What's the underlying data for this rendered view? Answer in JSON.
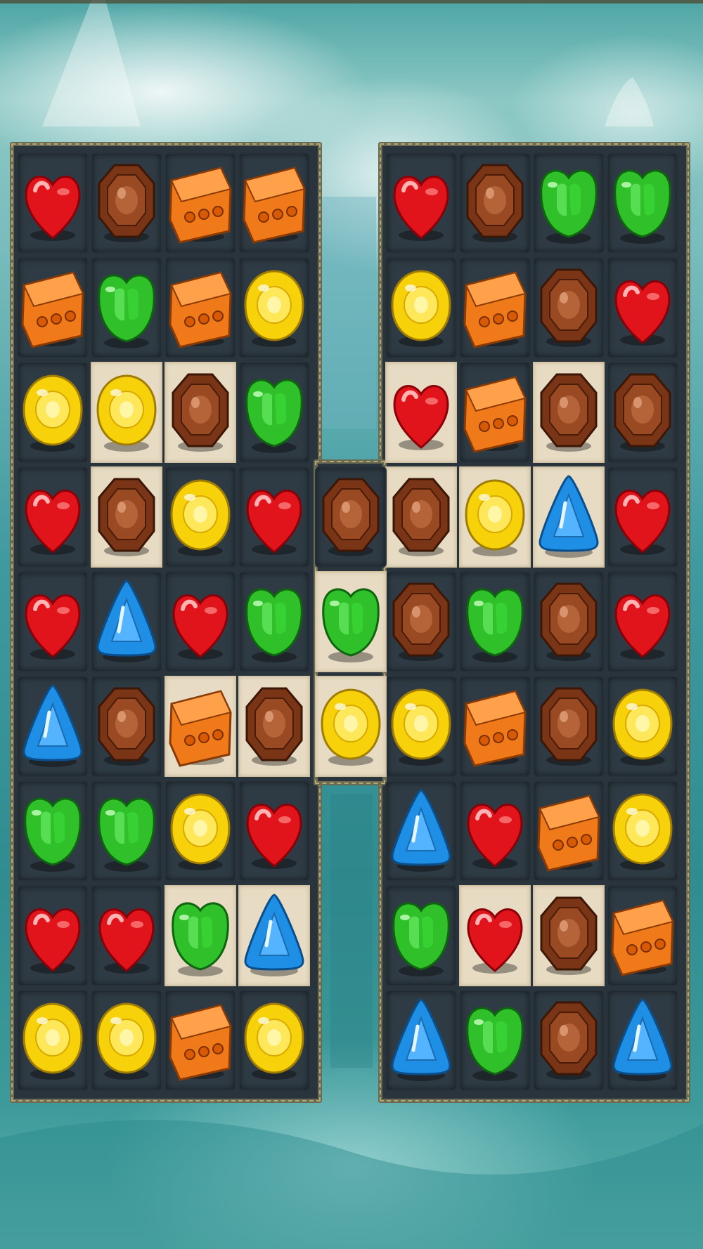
{
  "game": {
    "title": "",
    "colors": {
      "red": "#e0141a",
      "brown": "#7a3516",
      "orange": "#f07a1a",
      "green": "#2fc02a",
      "yellow": "#f7d20a",
      "blue": "#1f8fe6",
      "tile_dark": "#2f3b44",
      "tile_light": "#e7dcc3",
      "frame": "#6b6a52"
    },
    "left_board": {
      "rows": [
        [
          "heart",
          "octagon",
          "brick",
          "brick"
        ],
        [
          "brick",
          "apple",
          "brick",
          "round"
        ],
        [
          "round",
          "round",
          "octagon",
          "apple"
        ],
        [
          "heart",
          "octagon",
          "round",
          "heart"
        ],
        [
          "heart",
          "triangle",
          "heart",
          "apple"
        ],
        [
          "triangle",
          "octagon",
          "brick",
          "octagon"
        ],
        [
          "apple",
          "apple",
          "round",
          "heart"
        ],
        [
          "heart",
          "heart",
          "apple",
          "triangle"
        ],
        [
          "round",
          "round",
          "brick",
          "round"
        ]
      ],
      "light_cells": [
        [
          2,
          1
        ],
        [
          2,
          2
        ],
        [
          3,
          1
        ],
        [
          5,
          2
        ],
        [
          5,
          3
        ],
        [
          7,
          2
        ],
        [
          7,
          3
        ]
      ]
    },
    "bridge_column": {
      "rows": [
        {
          "row": 3,
          "candy": "octagon",
          "light": false
        },
        {
          "row": 4,
          "candy": "apple",
          "light": true
        },
        {
          "row": 5,
          "candy": "round",
          "light": true
        }
      ]
    },
    "right_board": {
      "rows": [
        [
          "heart",
          "octagon",
          "apple",
          "apple"
        ],
        [
          "round",
          "brick",
          "octagon",
          "heart"
        ],
        [
          "heart",
          "brick",
          "octagon",
          "octagon"
        ],
        [
          "octagon",
          "round",
          "triangle",
          "heart"
        ],
        [
          "octagon",
          "apple",
          "octagon",
          "heart"
        ],
        [
          "round",
          "brick",
          "octagon",
          "round"
        ],
        [
          "triangle",
          "heart",
          "brick",
          "round"
        ],
        [
          "apple",
          "heart",
          "octagon",
          "brick"
        ],
        [
          "triangle",
          "apple",
          "octagon",
          "triangle"
        ]
      ],
      "light_cells": [
        [
          2,
          0
        ],
        [
          2,
          2
        ],
        [
          3,
          0
        ],
        [
          3,
          1
        ],
        [
          3,
          2
        ],
        [
          7,
          1
        ],
        [
          7,
          2
        ]
      ]
    },
    "candy_types": {
      "heart": "red-heart-candy",
      "octagon": "brown-chocolate-candy",
      "brick": "orange-wafer-candy",
      "apple": "green-apple-candy",
      "round": "yellow-round-candy",
      "triangle": "blue-triangle-candy"
    }
  }
}
